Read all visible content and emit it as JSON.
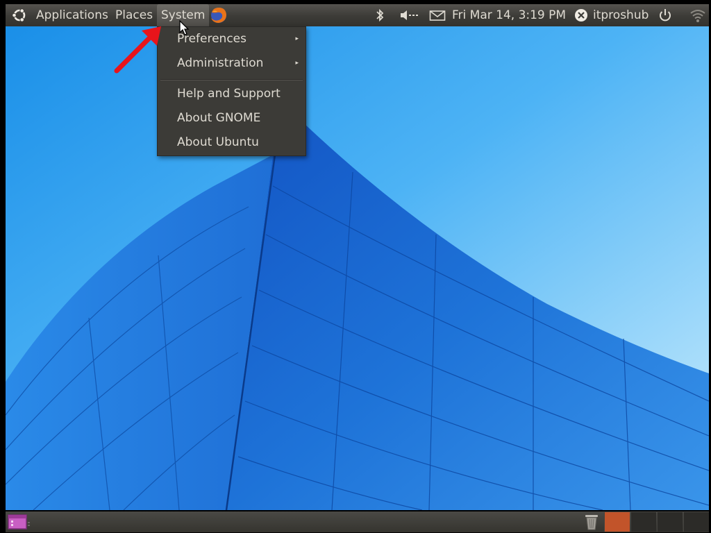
{
  "top_panel": {
    "menus": {
      "applications": "Applications",
      "places": "Places",
      "system": "System"
    },
    "clock": "Fri Mar 14,  3:19 PM",
    "username": "itproshub",
    "icons": [
      "ubuntu-logo-icon",
      "firefox-icon",
      "bluetooth-icon",
      "volume-icon",
      "mail-icon",
      "user-status-icon",
      "power-icon",
      "wifi-icon"
    ]
  },
  "system_menu": {
    "items": [
      {
        "label": "Preferences",
        "has_submenu": true
      },
      {
        "label": "Administration",
        "has_submenu": true
      },
      {
        "label": "Help and Support",
        "has_submenu": false
      },
      {
        "label": "About GNOME",
        "has_submenu": false
      },
      {
        "label": "About Ubuntu",
        "has_submenu": false
      }
    ],
    "submenu_arrow": "▸"
  },
  "bottom_panel": {
    "workspaces": 4,
    "current_workspace": 1,
    "icons": [
      "show-desktop-icon",
      "trash-icon"
    ]
  },
  "colors": {
    "panel": "#3c3b37",
    "panel_text": "#dfdbd2",
    "current_workspace": "#c2542a",
    "annotation": "#e8141b",
    "sky": "#3aa7f0",
    "building": "#1f6fd0"
  }
}
